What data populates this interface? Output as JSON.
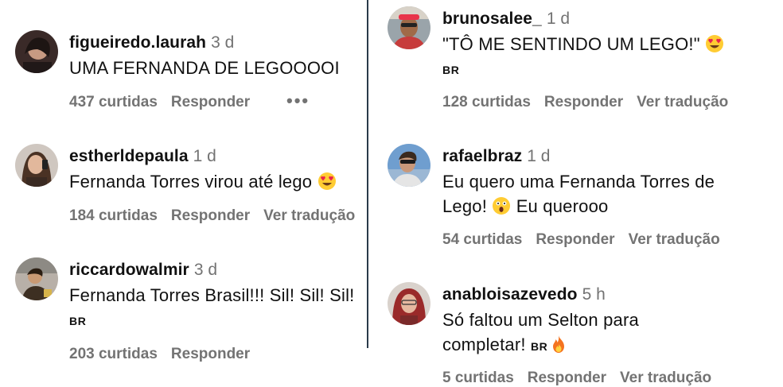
{
  "left_comments": [
    {
      "username": "figueiredo.laurah",
      "time": "3 d",
      "text": "UMA FERNANDA DE LEGOOOOI",
      "likes": "437 curtidas",
      "reply": "Responder",
      "more": "•••"
    },
    {
      "username": "estherldepaula",
      "time": "1 d",
      "text": "Fernanda Torres virou até lego",
      "likes": "184 curtidas",
      "reply": "Responder",
      "translate": "Ver tradução"
    },
    {
      "username": "riccardowalmir",
      "time": "3 d",
      "text": "Fernanda Torres Brasil!!! Sil! Sil! Sil!",
      "flag": "BR",
      "likes": "203 curtidas",
      "reply": "Responder"
    }
  ],
  "right_comments": [
    {
      "username": "brunosalee_",
      "time": "1 d",
      "text": "\"TÔ ME SENTINDO UM LEGO!\"",
      "flag": "BR",
      "likes": "128 curtidas",
      "reply": "Responder",
      "translate": "Ver tradução"
    },
    {
      "username": "rafaelbraz",
      "time": "1 d",
      "text_line1": "Eu quero uma Fernanda Torres de",
      "text_line2a": "Lego!",
      "text_line2b": "Eu querooo",
      "likes": "54 curtidas",
      "reply": "Responder",
      "translate": "Ver tradução"
    },
    {
      "username": "anabloisazevedo",
      "time": "5 h",
      "text_line1": "Só faltou um Selton para",
      "text_line2": "completar!",
      "flag": "BR",
      "likes": "5 curtidas",
      "reply": "Responder",
      "translate": "Ver tradução"
    }
  ],
  "icons": {
    "heart_eyes": "smiling-face-with-heart-eyes-icon",
    "surprised": "face-screaming-icon",
    "fire": "fire-icon",
    "more": "more-options-icon"
  }
}
